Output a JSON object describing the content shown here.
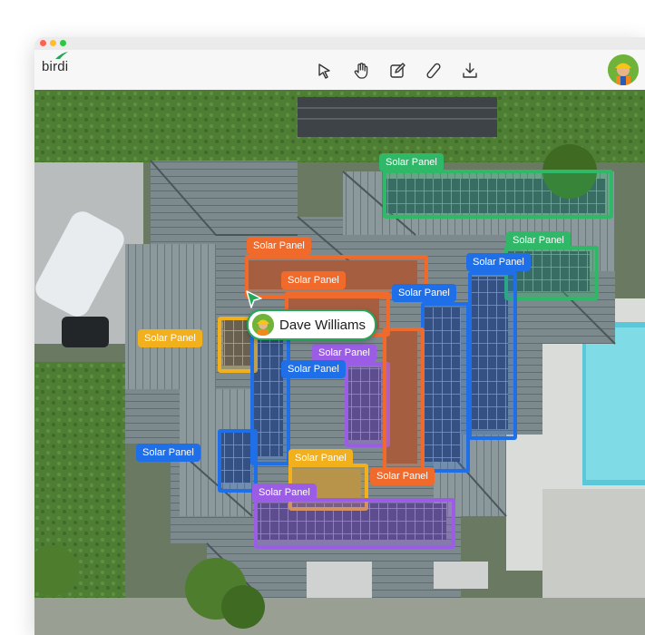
{
  "app": {
    "logo_text": "birdi",
    "brand_color": "#22a85b"
  },
  "toolbar": {
    "tools": [
      {
        "name": "select-pointer-icon"
      },
      {
        "name": "hand-pan-icon"
      },
      {
        "name": "edit-annotate-icon"
      },
      {
        "name": "measure-ruler-icon"
      },
      {
        "name": "download-icon"
      }
    ]
  },
  "collaborator": {
    "name": "Dave Williams"
  },
  "annotation_colors": {
    "green": "#2fb867",
    "orange": "#f06a2c",
    "blue": "#1f6fe8",
    "yellow": "#f2b01c",
    "purple": "#9b5de5"
  },
  "annotations": [
    {
      "label": "Solar Panel",
      "color": "green"
    },
    {
      "label": "Solar Panel",
      "color": "green"
    },
    {
      "label": "Solar Panel",
      "color": "orange"
    },
    {
      "label": "Solar Panel",
      "color": "orange"
    },
    {
      "label": "Solar Panel",
      "color": "blue"
    },
    {
      "label": "Solar Panel",
      "color": "blue"
    },
    {
      "label": "Solar Panel",
      "color": "yellow"
    },
    {
      "label": "Solar Panel",
      "color": "purple"
    },
    {
      "label": "Solar Panel",
      "color": "blue"
    },
    {
      "label": "Solar Panel",
      "color": "blue"
    },
    {
      "label": "Solar Panel",
      "color": "yellow"
    },
    {
      "label": "Solar Panel",
      "color": "orange"
    },
    {
      "label": "Solar Panel",
      "color": "purple"
    }
  ]
}
